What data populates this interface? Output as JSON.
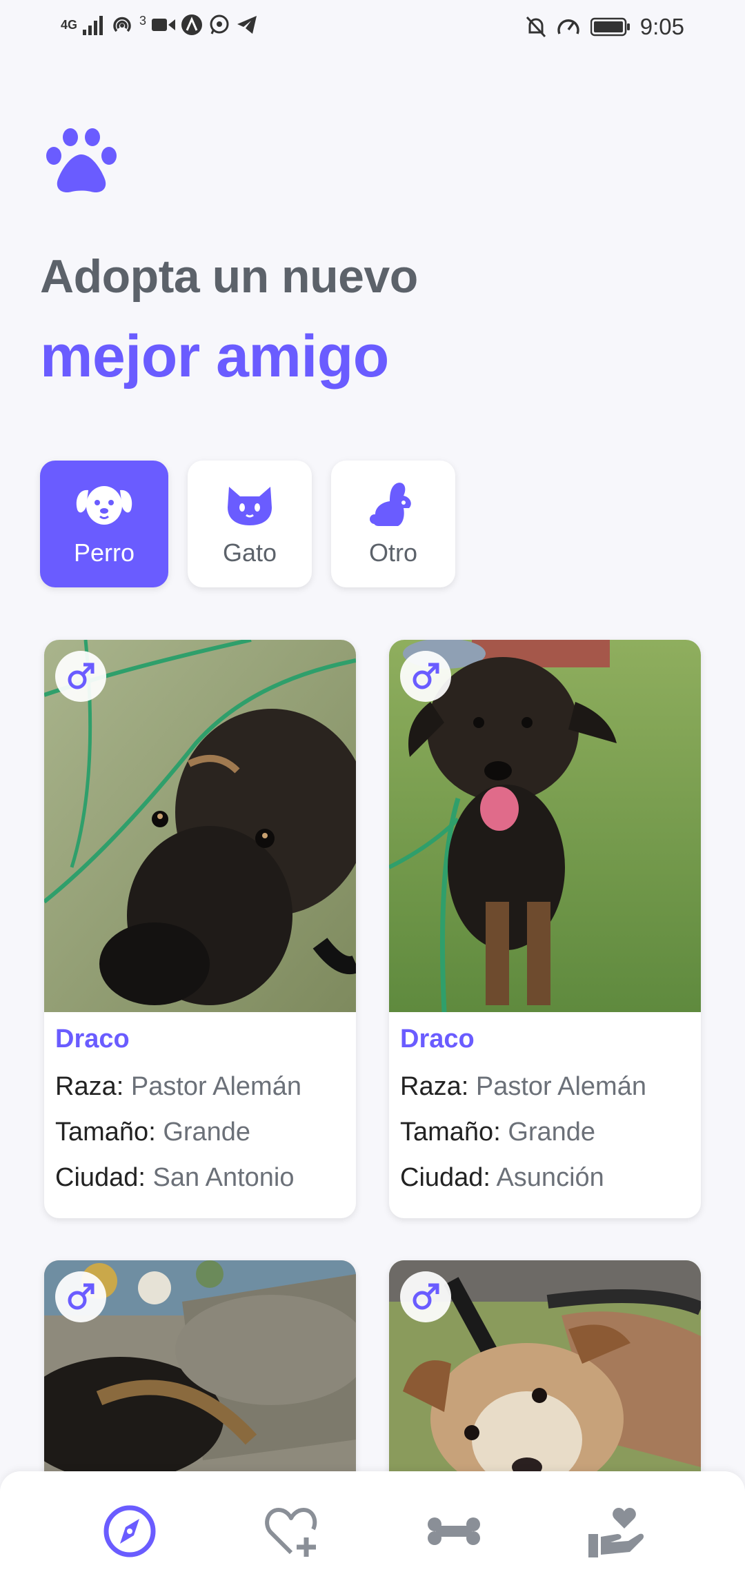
{
  "status_bar": {
    "network": "4G",
    "hotspot_count": "3",
    "time": "9:05"
  },
  "header": {
    "line1": "Adopta un nuevo",
    "line2": "mejor amigo"
  },
  "categories": [
    {
      "label": "Perro",
      "icon": "dog-icon",
      "selected": true
    },
    {
      "label": "Gato",
      "icon": "cat-icon",
      "selected": false
    },
    {
      "label": "Otro",
      "icon": "rabbit-icon",
      "selected": false
    }
  ],
  "labels": {
    "breed": "Raza:",
    "size": "Tamaño:",
    "city": "Ciudad:"
  },
  "pets": [
    {
      "name": "Draco",
      "breed": "Pastor Alemán",
      "size": "Grande",
      "city": "San Antonio",
      "gender": "male-icon"
    },
    {
      "name": "Draco",
      "breed": "Pastor Alemán",
      "size": "Grande",
      "city": "Asunción",
      "gender": "male-icon"
    },
    {
      "gender": "male-icon"
    },
    {
      "gender": "male-icon"
    }
  ],
  "bottom_nav": [
    {
      "icon": "compass-icon",
      "active": true
    },
    {
      "icon": "heart-plus-icon",
      "active": false
    },
    {
      "icon": "bone-icon",
      "active": false
    },
    {
      "icon": "hand-heart-icon",
      "active": false
    }
  ],
  "colors": {
    "accent": "#6a5cff",
    "title_gray": "#5c626a",
    "inactive_icon": "#8a8f97"
  }
}
